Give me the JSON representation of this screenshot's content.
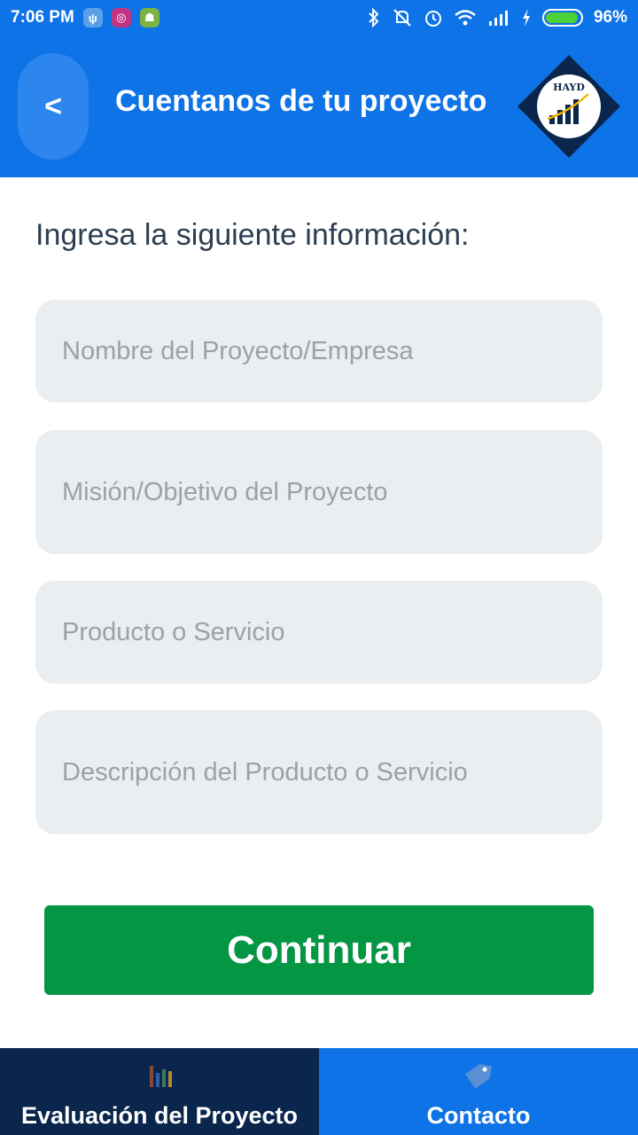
{
  "status_bar": {
    "time": "7:06 PM",
    "battery": "96%",
    "battery_level": 0.96,
    "icons": [
      "usb-icon",
      "instagram-icon",
      "android-icon",
      "bluetooth-icon",
      "mute-icon",
      "alarm-icon",
      "wifi-icon",
      "signal-icon",
      "charging-icon",
      "battery-icon"
    ]
  },
  "header": {
    "back_label": "<",
    "title": "Cuentanos de tu proyecto",
    "logo_text": "HAYD"
  },
  "form": {
    "instruction": "Ingresa la siguiente información:",
    "fields": [
      {
        "placeholder": "Nombre del Proyecto/Empresa",
        "value": ""
      },
      {
        "placeholder": "Misión/Objetivo del Proyecto",
        "value": ""
      },
      {
        "placeholder": "Producto o Servicio",
        "value": ""
      },
      {
        "placeholder": "Descripción del Producto o Servicio",
        "value": ""
      }
    ],
    "continue_label": "Continuar"
  },
  "bottom_nav": {
    "items": [
      {
        "label": "Evaluación del Proyecto",
        "icon": "bar-chart-icon",
        "active": true
      },
      {
        "label": "Contacto",
        "icon": "tag-icon",
        "active": false
      }
    ]
  },
  "colors": {
    "primary": "#0e73e6",
    "dark_nav": "#0a264d",
    "button_green": "#049642",
    "field_bg": "#eaeef1"
  }
}
